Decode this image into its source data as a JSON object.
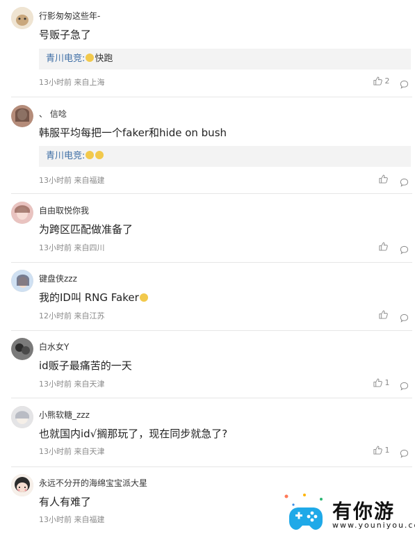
{
  "comments": [
    {
      "name": "行影匆匆这些年-",
      "text": "号贩子急了",
      "reply": {
        "user": "青川电竞:",
        "text": "快跑",
        "emoji_count": 1
      },
      "meta": "13小时前 来自上海",
      "likes": "2"
    },
    {
      "name": "、 信唸",
      "text": "韩服平均每把一个faker和hide on bush",
      "reply": {
        "user": "青川电竞:",
        "text": "",
        "emoji_count": 2
      },
      "meta": "13小时前 来自福建",
      "likes": ""
    },
    {
      "name": "自由取悦你我",
      "text": "为跨区匹配做准备了",
      "meta": "13小时前 来自四川",
      "likes": ""
    },
    {
      "name": "键盘侠zzz",
      "text": "我的ID叫 RNG Faker",
      "meta": "12小时前 来自江苏",
      "likes": ""
    },
    {
      "name": "白水女Y",
      "text": "id贩子最痛苦的一天",
      "meta": "13小时前 来自天津",
      "likes": "1"
    },
    {
      "name": "小熊软糖_zzz",
      "text": "也就国内id√搁那玩了，现在同步就急了?",
      "meta": "13小时前 来自天津",
      "likes": "1"
    },
    {
      "name": "永远不分开的海绵宝宝派大星",
      "text": "有人有难了",
      "meta": "13小时前 来自福建",
      "likes": ""
    }
  ],
  "watermark": {
    "title": "有你游",
    "url": "www.youniyou.com"
  },
  "colors": {
    "reply_user": "#3f6fa6",
    "meta": "#8a8a8a",
    "divider": "#e6e6e6",
    "reply_bg": "#f3f3f3"
  }
}
